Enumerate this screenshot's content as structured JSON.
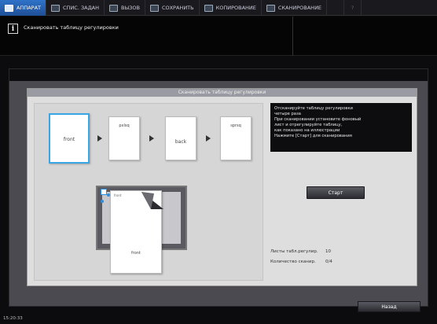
{
  "tabs": [
    {
      "label": "АППАРАТ",
      "active": true
    },
    {
      "label": "СПИС. ЗАДАН",
      "active": false
    },
    {
      "label": "ВЫЗОВ",
      "active": false
    },
    {
      "label": "СОХРАНИТЬ",
      "active": false
    },
    {
      "label": "КОПИРОВАНИЕ",
      "active": false
    },
    {
      "label": "СКАНИРОВАНИЕ",
      "active": false
    },
    {
      "label": "",
      "active": false
    },
    {
      "label": "?",
      "active": false
    }
  ],
  "message": {
    "icon": "i",
    "text": "Сканировать таблицу регулировки"
  },
  "dialog": {
    "title": "Сканировать таблицу регулировки",
    "sheets": [
      "front",
      "pxlsq",
      "back",
      "sprsq"
    ],
    "paper_label_top": "front",
    "paper_label_bottom": "front",
    "instructions": [
      "Отсканируйте таблицу регулировки",
      "четыре раза",
      "При сканировании установите фоновый",
      "лист и отрегулируйте таблицу,",
      "как показано на иллюстрации",
      "Нажмите [Старт] для сканирования"
    ],
    "start_label": "Старт",
    "stats": [
      {
        "label": "Листы табл.регулир.",
        "value": "10"
      },
      {
        "label": "Количество сканир.",
        "value": "0/4"
      }
    ]
  },
  "back_label": "Назад",
  "clock": "15:20:33",
  "colors": {
    "accent": "#2f73c8",
    "highlight": "#3aa6e6"
  }
}
